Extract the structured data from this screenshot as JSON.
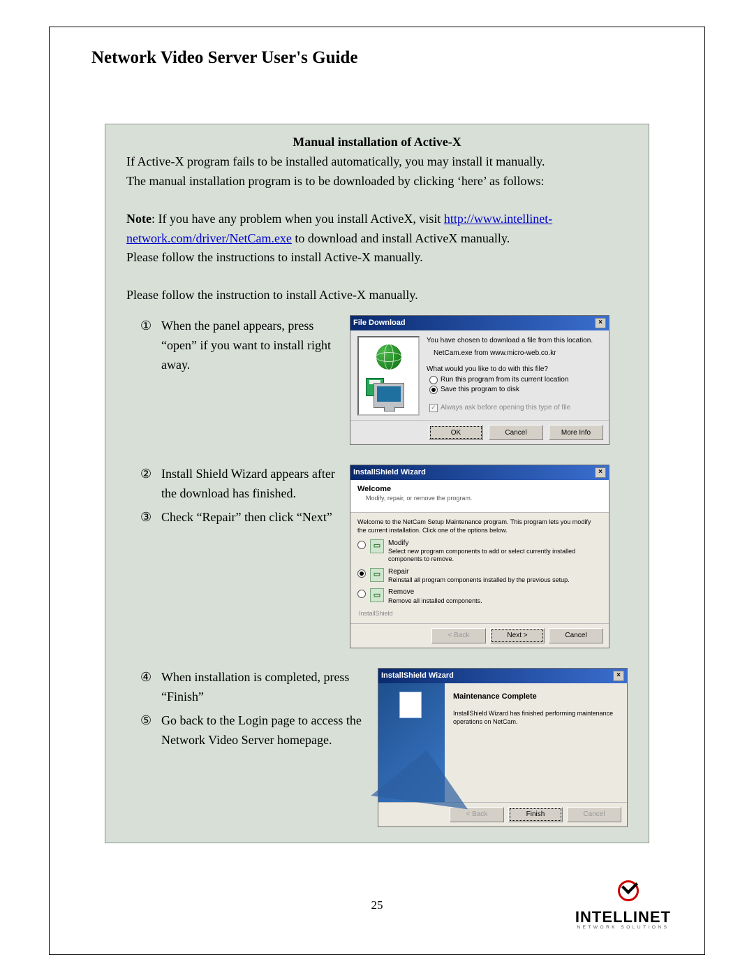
{
  "header": {
    "title": "Network Video Server User's Guide"
  },
  "panel": {
    "title": "Manual installation of Active-X",
    "intro1": "If Active-X program fails to be installed automatically, you may install it manually.",
    "intro2": "The manual installation program is to be downloaded by clicking ‘here’ as follows:",
    "note_pre": "Note",
    "note_mid": ": If you have any problem when you install ActiveX, visit ",
    "note_link": "http://www.intellinet-network.com/driver/NetCam.exe",
    "note_post": " to download and install ActiveX manually.",
    "note_line2": "Please follow the instructions to install Active-X manually.",
    "instr_intro": "Please follow the instruction to install Active-X manually.",
    "step1": "When the panel appears, press “open” if you want to install right away.",
    "step2": "Install Shield Wizard appears after the download has finished.",
    "step3": "Check “Repair” then click “Next”",
    "step4": "When installation is completed, press “Finish”",
    "step5": "Go back to the Login page to access the Network Video Server homepage.",
    "n1": "①",
    "n2": "②",
    "n3": "③",
    "n4": "④",
    "n5": "⑤"
  },
  "dlg1": {
    "title": "File Download",
    "line1": "You have chosen to download a file from this location.",
    "line2": "NetCam.exe from www.micro-web.co.kr",
    "question": "What would you like to do with this file?",
    "opt_run": "Run this program from its current location",
    "opt_save": "Save this program to disk",
    "always": "Always ask before opening this type of file",
    "btn_ok": "OK",
    "btn_cancel": "Cancel",
    "btn_more": "More Info"
  },
  "dlg2": {
    "title": "InstallShield Wizard",
    "welcome": "Welcome",
    "welcome_sub": "Modify, repair, or remove the program.",
    "intro": "Welcome to the NetCam Setup Maintenance program. This program lets you modify the current installation. Click one of the options below.",
    "modify_label": "Modify",
    "modify_desc": "Select new program components to add or select currently installed components to remove.",
    "repair_label": "Repair",
    "repair_desc": "Reinstall all program components installed by the previous setup.",
    "remove_label": "Remove",
    "remove_desc": "Remove all installed components.",
    "progress_label": "InstallShield",
    "btn_back": "< Back",
    "btn_next": "Next >",
    "btn_cancel": "Cancel"
  },
  "dlg3": {
    "title": "InstallShield Wizard",
    "heading": "Maintenance Complete",
    "desc": "InstallShield Wizard has finished performing maintenance operations on NetCam.",
    "btn_back": "< Back",
    "btn_finish": "Finish",
    "btn_cancel": "Cancel"
  },
  "footer": {
    "page_number": "25",
    "brand": "INTELLINET",
    "tagline": "NETWORK SOLUTIONS"
  }
}
